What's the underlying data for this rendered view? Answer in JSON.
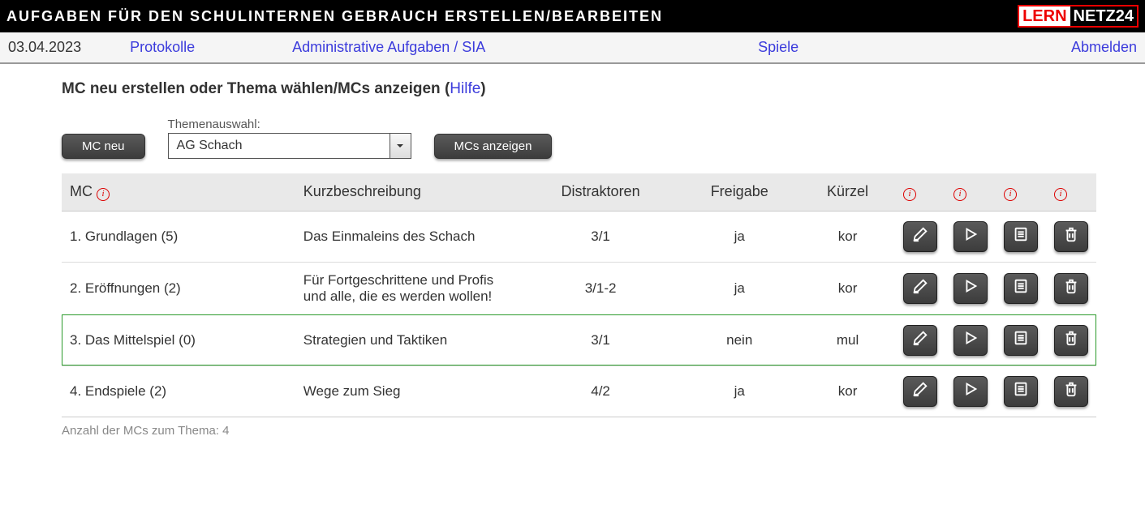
{
  "header": {
    "title": "AUFGABEN FÜR DEN SCHULINTERNEN GEBRAUCH ERSTELLEN/BEARBEITEN",
    "logo_left": "LERN",
    "logo_right": "NETZ24"
  },
  "nav": {
    "date": "03.04.2023",
    "protokolle": "Protokolle",
    "admin": "Administrative Aufgaben / SIA",
    "spiele": "Spiele",
    "abmelden": "Abmelden"
  },
  "section": {
    "title_main": "MC neu erstellen oder Thema wählen/MCs anzeigen",
    "help_label": "Hilfe"
  },
  "controls": {
    "mc_neu": "MC neu",
    "themenauswahl_label": "Themenauswahl:",
    "themenauswahl_value": "AG Schach",
    "mcs_anzeigen": "MCs anzeigen"
  },
  "table": {
    "headers": {
      "mc": "MC",
      "kurz": "Kurzbeschreibung",
      "distraktoren": "Distraktoren",
      "freigabe": "Freigabe",
      "kuerzel": "Kürzel"
    },
    "rows": [
      {
        "mc": "1. Grundlagen (5)",
        "kurz": "Das Einmaleins des Schach",
        "distraktoren": "3/1",
        "freigabe": "ja",
        "kuerzel": "kor",
        "highlight": false
      },
      {
        "mc": "2. Eröffnungen (2)",
        "kurz": "Für Fortgeschrittene und Profis und alle, die es werden wollen!",
        "distraktoren": "3/1-2",
        "freigabe": "ja",
        "kuerzel": "kor",
        "highlight": false
      },
      {
        "mc": "3. Das Mittelspiel (0)",
        "kurz": "Strategien und Taktiken",
        "distraktoren": "3/1",
        "freigabe": "nein",
        "kuerzel": "mul",
        "highlight": true
      },
      {
        "mc": "4. Endspiele (2)",
        "kurz": "Wege zum Sieg",
        "distraktoren": "4/2",
        "freigabe": "ja",
        "kuerzel": "kor",
        "highlight": false
      }
    ],
    "footer": "Anzahl der MCs zum Thema: 4"
  },
  "icons": {
    "edit": "edit-icon",
    "play": "play-icon",
    "list": "list-icon",
    "trash": "trash-icon",
    "info": "info-icon"
  }
}
